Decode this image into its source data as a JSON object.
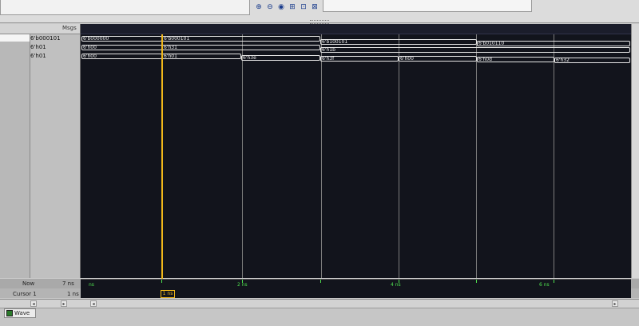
{
  "toolbar": {
    "zoom_icons": [
      "zoom-in-icon",
      "zoom-out-icon",
      "zoom-full-icon",
      "zoom-cursor-icon",
      "zoom-last-icon",
      "zoom-region-icon"
    ],
    "zoom_glyphs": [
      "⊕",
      "⊖",
      "◉",
      "⊞",
      "⊡",
      "⊠"
    ]
  },
  "panes": {
    "msgs_header": "Msgs"
  },
  "signals": [
    {
      "value": "6'b000101"
    },
    {
      "value": "6'h01"
    },
    {
      "value": "6'h01"
    }
  ],
  "waves": [
    {
      "segments": [
        {
          "label": "6'b000000"
        },
        {
          "label": "6'b000101"
        },
        {
          "label": "6'b100101"
        },
        {
          "label": "6'b010110"
        }
      ]
    },
    {
      "segments": [
        {
          "label": "6'h00"
        },
        {
          "label": "6'h31"
        },
        {
          "label": "6'h1b"
        }
      ]
    },
    {
      "segments": [
        {
          "label": "6'h00"
        },
        {
          "label": "6'h01"
        },
        {
          "label": "6'h3e"
        },
        {
          "label": "6'h3f"
        },
        {
          "label": "6'h00"
        },
        {
          "label": "6'h0d"
        },
        {
          "label": "6'h32"
        }
      ]
    }
  ],
  "bottom": {
    "now_label": "Now",
    "now_value": "7 ns",
    "cursor_label": "Cursor 1",
    "cursor_value": "1 ns",
    "cursor_marker": "1 ns",
    "timeline_ticks": [
      "ns",
      "2 ns",
      "4 ns",
      "6 ns"
    ]
  },
  "tabs": {
    "wave_label": "Wave"
  },
  "colors": {
    "wave_bg": "#12141c",
    "cursor": "#f1b81a",
    "timeline": "#4fe04f"
  }
}
